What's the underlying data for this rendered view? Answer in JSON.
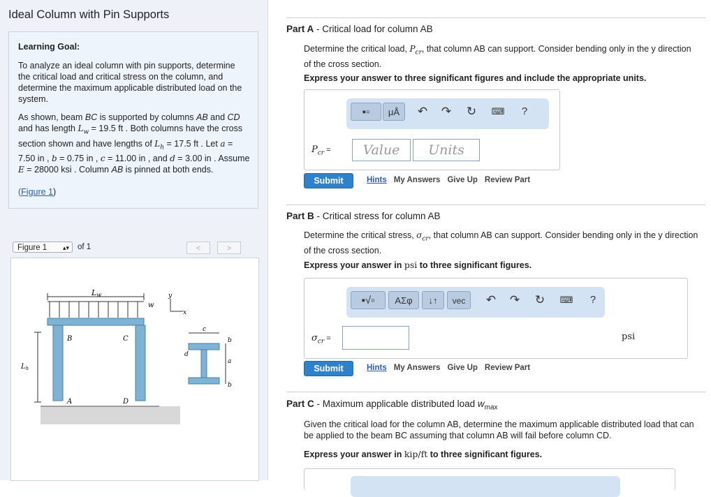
{
  "page_title": "Ideal Column with Pin Supports",
  "learning_goal": {
    "heading": "Learning Goal:",
    "p1": "To analyze an ideal column with pin supports, determine the critical load and critical stress on the column, and determine the maximum applicable distributed load on the system.",
    "p2_a": "As shown, beam ",
    "p2_b": "BC",
    "p2_c": " is supported by columns ",
    "p2_d": "AB",
    "p2_e": " and ",
    "p2_f": "CD",
    "p2_g": " and has length ",
    "Lw": "L",
    "Lw_sub": "w",
    "p2_h": " = 19.5 ft . Both columns have the cross section shown and have lengths of ",
    "Lh": "L",
    "Lh_sub": "h",
    "p2_i": " = 17.5 ft . Let ",
    "a": "a",
    "p2_j": " = 7.50 in , ",
    "b": "b",
    "p2_k": " = 0.75 in , ",
    "c": "c",
    "p2_l": " = 11.00 in , and ",
    "d": "d",
    "p2_m": " = 3.00 in . Assume ",
    "E": "E",
    "p2_n": " = 28000 ksi . Column ",
    "p2_o": "AB",
    "p2_p": " is pinned at both ends.",
    "figure_link": "Figure 1",
    "figure_link_pre": "(",
    "figure_link_post": ")"
  },
  "figure_nav": {
    "selected": "Figure 1",
    "of": "of 1",
    "prev": "<",
    "next": ">"
  },
  "figure": {
    "Lw": "L",
    "Lw_sub": "w",
    "w": "w",
    "y": "y",
    "x": "x",
    "B": "B",
    "C": "C",
    "A": "A",
    "D": "D",
    "Lh": "L",
    "Lh_sub": "h",
    "c": "c",
    "b_top": "b",
    "b_bot": "b",
    "a": "a",
    "d": "d"
  },
  "partA": {
    "label": "Part A",
    "title": " - Critical load for column AB",
    "text1": "Determine the critical load, ",
    "sym": "P",
    "sym_sub": "cr",
    "text2": ", that column AB can support. Consider bending only in the y direction of the cross section.",
    "instr": "Express your answer to three significant figures and include the appropriate units.",
    "var_label": "P",
    "var_sub": "cr",
    "eq": " =",
    "value_placeholder": "Value",
    "units_placeholder": "Units",
    "toolbar": {
      "mu": "μÅ",
      "help": "?"
    },
    "submit": "Submit",
    "links": [
      "Hints",
      "My Answers",
      "Give Up",
      "Review Part"
    ]
  },
  "partB": {
    "label": "Part B",
    "title": " - Critical stress for column AB",
    "text1": "Determine the critical stress, ",
    "sym": "σ",
    "sym_sub": "cr",
    "text2": ", that column AB can support. Consider bending only in the y direction of the cross section.",
    "instr_a": "Express your answer in ",
    "instr_unit": "psi",
    "instr_b": " to three significant figures.",
    "var_label": "σ",
    "var_sub": "cr",
    "eq": " =",
    "unit": "psi",
    "toolbar": {
      "greek": "ΑΣφ",
      "arrows": "↓↑",
      "vec": "vec",
      "help": "?"
    },
    "submit": "Submit",
    "links": [
      "Hints",
      "My Answers",
      "Give Up",
      "Review Part"
    ]
  },
  "partC": {
    "label": "Part C",
    "title_a": " - Maximum applicable distributed load ",
    "sym": "w",
    "sym_sub": "max",
    "text": "Given the critical load for the column AB, determine the maximum applicable distributed load that can be applied to the beam BC assuming that column AB will fail before column CD.",
    "instr_a": "Express your answer in ",
    "instr_unit": "kip/ft",
    "instr_b": " to three significant figures."
  }
}
